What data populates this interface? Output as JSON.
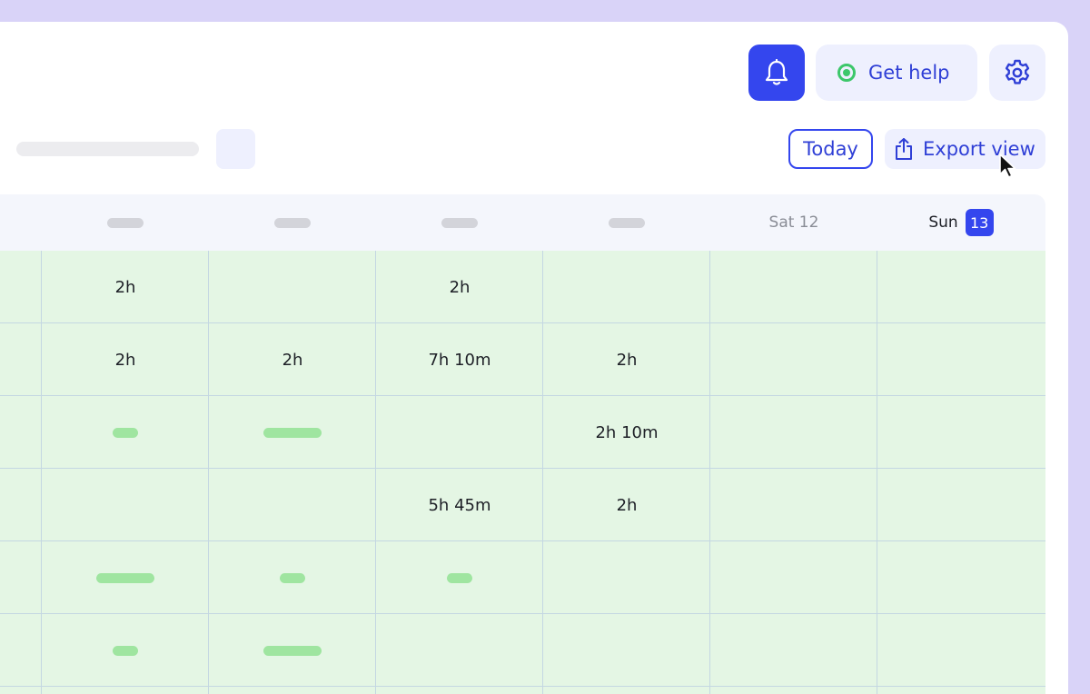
{
  "header": {
    "help_label": "Get help",
    "bell_icon": "bell-icon",
    "settings_icon": "gear-icon",
    "status_color": "#3cc76a",
    "accent_color": "#3446ee"
  },
  "toolbar": {
    "today_label": "Today",
    "export_label": "Export view",
    "export_icon": "share-export-icon"
  },
  "calendar": {
    "days": [
      {
        "label": "",
        "placeholder": true
      },
      {
        "label": "",
        "placeholder": true
      },
      {
        "label": "",
        "placeholder": true
      },
      {
        "label": "",
        "placeholder": true
      },
      {
        "label": "Sat 12",
        "placeholder": false
      },
      {
        "label": "Sun",
        "badge": "13",
        "today": true
      }
    ],
    "rows": [
      [
        "2h",
        "",
        "2h",
        "",
        "",
        ""
      ],
      [
        "2h",
        "2h",
        "7h 10m",
        "2h",
        "",
        ""
      ],
      [
        "",
        "",
        "",
        "2h 10m",
        "",
        ""
      ],
      [
        "",
        "",
        "5h 45m",
        "2h",
        "",
        ""
      ],
      [
        "",
        "",
        "",
        "",
        "",
        ""
      ],
      [
        "",
        "",
        "",
        "",
        "",
        ""
      ]
    ],
    "cell_color": "#e4f6e4"
  }
}
